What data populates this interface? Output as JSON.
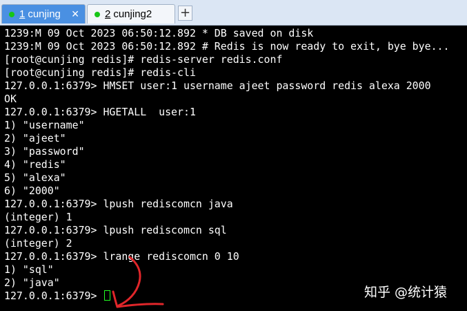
{
  "tabs": [
    {
      "number": "1",
      "label": "cunjing",
      "active": true,
      "close": "✕"
    },
    {
      "number": "2",
      "label": "cunjing2",
      "active": false
    }
  ],
  "new_tab_label": "+",
  "colors": {
    "tab_active": "#4a90e2",
    "tab_status_dot": "#17c617",
    "terminal_bg": "#000000",
    "terminal_text": "#ffffff",
    "cursor": "#22ff22",
    "annotation_arrow": "#e0262a"
  },
  "terminal": {
    "lines": [
      "1239:M 09 Oct 2023 06:50:12.892 * DB saved on disk",
      "1239:M 09 Oct 2023 06:50:12.892 # Redis is now ready to exit, bye bye...",
      "[root@cunjing redis]# redis-server redis.conf",
      "[root@cunjing redis]# redis-cli",
      "127.0.0.1:6379> HMSET user:1 username ajeet password redis alexa 2000",
      "OK",
      "127.0.0.1:6379> HGETALL  user:1",
      "1) \"username\"",
      "2) \"ajeet\"",
      "3) \"password\"",
      "4) \"redis\"",
      "5) \"alexa\"",
      "6) \"2000\"",
      "127.0.0.1:6379> lpush rediscomcn java",
      "(integer) 1",
      "127.0.0.1:6379> lpush rediscomcn sql",
      "(integer) 2",
      "127.0.0.1:6379> lrange rediscomcn 0 10",
      "1) \"sql\"",
      "2) \"java\""
    ],
    "prompt": "127.0.0.1:6379> "
  },
  "watermark": "知乎 @统计猿",
  "annotation_icon": "hand-drawn-arrow-icon"
}
